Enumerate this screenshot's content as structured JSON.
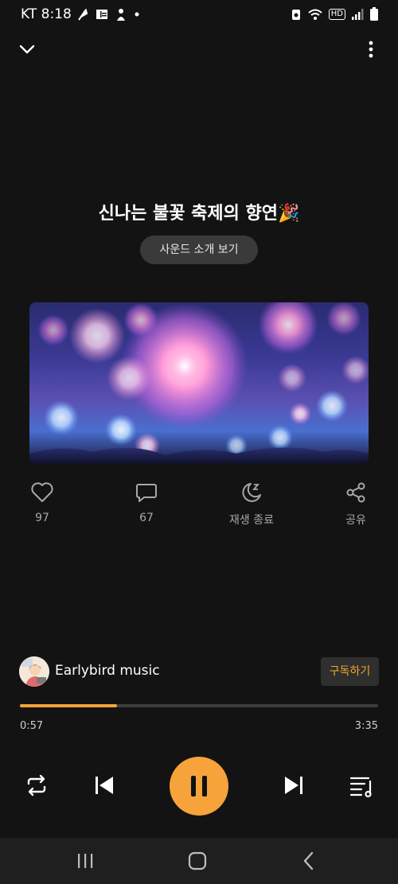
{
  "status": {
    "carrier": "KT",
    "time": "8:18",
    "network": "HD"
  },
  "track": {
    "title": "신나는 불꽃 축제의 향연🎉",
    "intro_button": "사운드 소개 보기"
  },
  "actions": {
    "like_count": "97",
    "comment_count": "67",
    "sleep_label": "재생 종료",
    "share_label": "공유"
  },
  "channel": {
    "name": "Earlybird music",
    "subscribe_label": "구독하기"
  },
  "playback": {
    "current_time": "0:57",
    "total_time": "3:35",
    "progress": 0.27
  },
  "colors": {
    "accent": "#f5a33a",
    "background": "#131313"
  },
  "icons": {
    "header": [
      "chevron-down-icon",
      "more-vertical-icon"
    ],
    "actions": [
      "heart-icon",
      "comment-icon",
      "sleep-timer-icon",
      "share-icon"
    ],
    "controls": [
      "repeat-icon",
      "skip-previous-icon",
      "pause-icon",
      "skip-next-icon",
      "playlist-icon"
    ],
    "nav": [
      "recent-apps-icon",
      "home-icon",
      "back-icon"
    ]
  }
}
